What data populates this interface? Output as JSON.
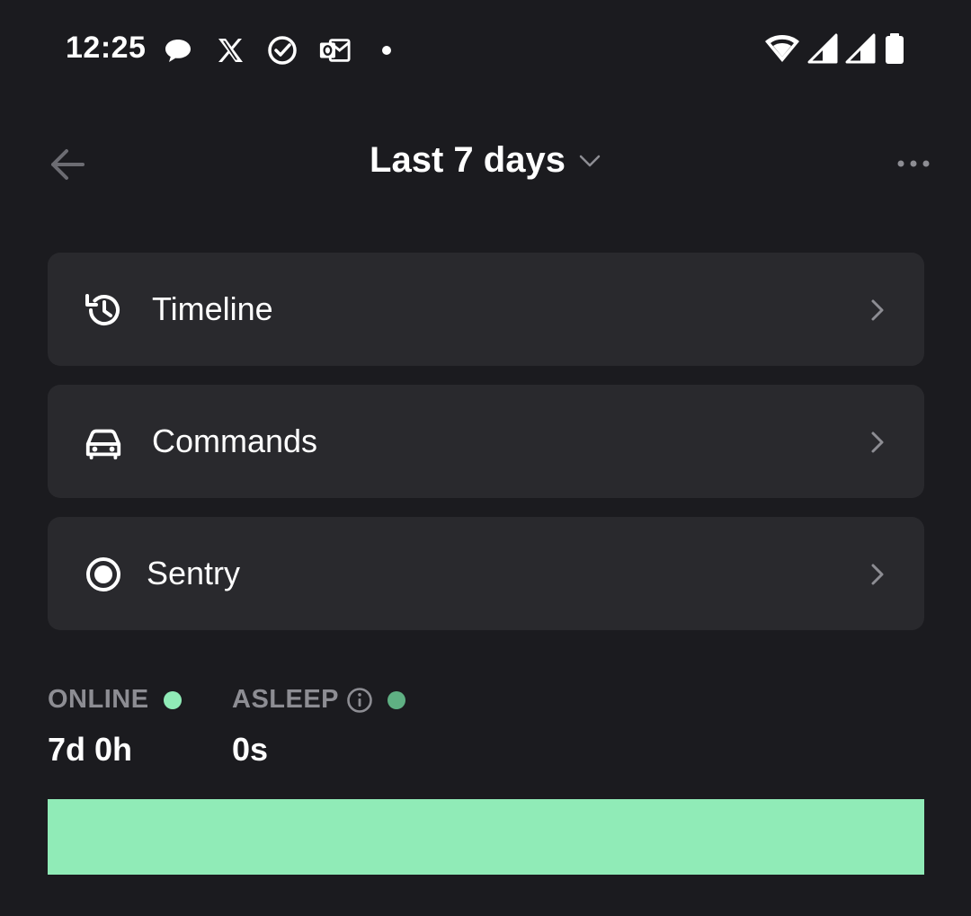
{
  "status_bar": {
    "time": "12:25",
    "notification_icons": [
      "chat-bubble-icon",
      "x-logo-icon",
      "check-circle-icon",
      "outlook-icon",
      "dot-icon"
    ],
    "system_icons": [
      "wifi-icon",
      "signal-icon",
      "signal-icon",
      "battery-icon"
    ]
  },
  "header": {
    "title": "Last 7 days",
    "back_icon": "arrow-left-icon",
    "dropdown_icon": "chevron-down-icon",
    "more_icon": "more-horizontal-icon"
  },
  "menu": {
    "items": [
      {
        "label": "Timeline",
        "icon": "history-icon"
      },
      {
        "label": "Commands",
        "icon": "car-icon"
      },
      {
        "label": "Sentry",
        "icon": "record-circle-icon"
      }
    ]
  },
  "stats": {
    "online": {
      "label": "ONLINE",
      "value": "7d 0h",
      "color": "#90ebb7"
    },
    "asleep": {
      "label": "ASLEEP",
      "value": "0s",
      "color": "#5fb083",
      "info_icon": "info-icon"
    }
  },
  "usage_bar": {
    "online_fraction": 1.0,
    "color": "#90ebb7"
  }
}
